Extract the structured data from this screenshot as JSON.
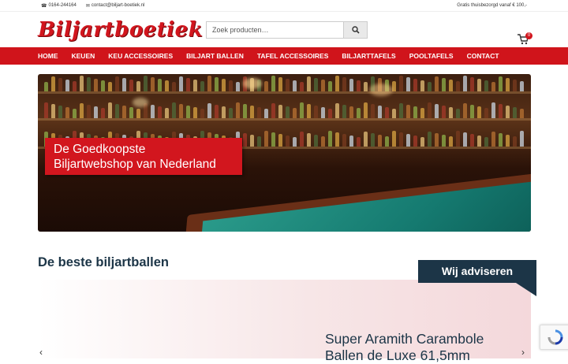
{
  "topbar": {
    "phone": "0164-244164",
    "email": "contact@biljart-boetiek.nl",
    "shipping": "Gratis thuisbezorgd vanaf € 100,-"
  },
  "header": {
    "logo_text": "Biljartboetiek",
    "search_placeholder": "Zoek producten…",
    "cart_count": "0"
  },
  "nav": {
    "items": [
      {
        "label": "HOME"
      },
      {
        "label": "KEUEN"
      },
      {
        "label": "KEU ACCESSOIRES"
      },
      {
        "label": "BILJART BALLEN"
      },
      {
        "label": "TAFEL ACCESSOIRES"
      },
      {
        "label": "BILJARTTAFELS"
      },
      {
        "label": "POOLTAFELS"
      },
      {
        "label": "CONTACT"
      }
    ]
  },
  "hero": {
    "caption_line1": "De Goedkoopste",
    "caption_line2": "Biljartwebshop van Nederland"
  },
  "section": {
    "title": "De beste biljartballen",
    "advise_label": "Wij adviseren",
    "product_line1": "Super Aramith Carambole",
    "product_line2": "Ballen de Luxe 61,5mm"
  },
  "colors": {
    "brand_red": "#d0141b",
    "navy": "#1c3547"
  }
}
